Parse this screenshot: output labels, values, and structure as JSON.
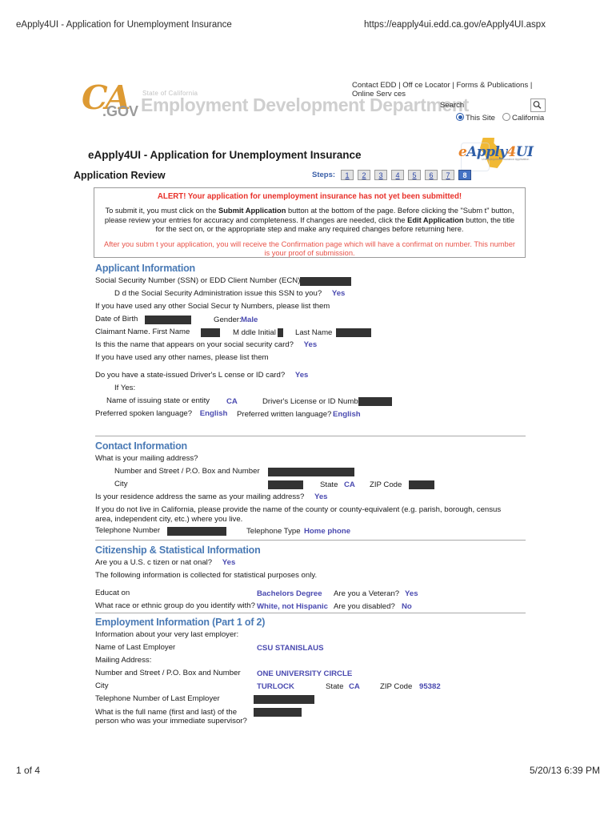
{
  "print": {
    "header_title": "eApply4UI - Application for Unemployment Insurance",
    "header_url": "https://eapply4ui.edd.ca.gov/eApply4UI.aspx",
    "footer_page": "1 of 4",
    "footer_date": "5/20/13 6:39 PM"
  },
  "banner": {
    "logo_ca": "CA",
    "logo_gov": ".GOV",
    "state_line": "State of California",
    "department": "Employment Development Department",
    "links": [
      "Contact EDD",
      "Off ce Locator",
      "Forms & Publications",
      "Online Serv ces"
    ],
    "separator": "|",
    "search_label": "Search",
    "search_icon": "search-icon",
    "scope_options": [
      {
        "label": "This Site",
        "selected": true
      },
      {
        "label": "California",
        "selected": false
      }
    ]
  },
  "logo": {
    "e": "e",
    "apply": "Apply",
    "four": "4",
    "ui": "UI",
    "tagline": "Unemployment Insurance Application"
  },
  "header": {
    "page_title": "eApply4UI - Application for Unemployment Insurance",
    "review_title": "Application Review",
    "steps_label": "Steps:",
    "steps": [
      "1",
      "2",
      "3",
      "4",
      "5",
      "6",
      "7",
      "8"
    ],
    "current_step": "8"
  },
  "alert": {
    "headline": "ALERT! Your application for unemployment insurance has not yet been submitted!",
    "body_1": "To submit it, you must click on the ",
    "body_bold_1": "Submit Application",
    "body_2": " button at the bottom of the page. Before clicking the \"Subm t\" button, please review your entries for accuracy and completeness. If changes are needed, click the ",
    "body_bold_2": "Edit Application",
    "body_3": " button, the title for the sect on, or the appropriate step and make any required changes before returning here.",
    "footer": "After you subm t your application, you will receive the Confirmation page which will have a confirmat on number. This number is your proof of submission."
  },
  "applicant": {
    "heading": "Applicant Information",
    "ssn_label": "Social Security Number (SSN) or EDD Client Number (ECN)",
    "ssn_value": "",
    "ssa_issue_label": "D d the Social Security Administration issue this SSN to you?",
    "ssa_issue_value": "Yes",
    "other_ssn_label": "If you have used any other Social Secur ty Numbers, please list them",
    "dob_label": "Date of Birth",
    "dob_value": "",
    "gender_label": "Gender:",
    "gender_value": "Male",
    "name_label": "Claimant Name.",
    "first_name_label": "First Name",
    "first_name_value": "",
    "middle_initial_label": "M ddle Initial",
    "middle_initial_value": "",
    "last_name_label": "Last Name",
    "last_name_value": "",
    "ss_card_label": "Is this the name that appears on your social security card?",
    "ss_card_value": "Yes",
    "other_names_label": "If you have used any other names, please list them",
    "dl_label": "Do you have a state-issued Driver's L cense or ID card?",
    "dl_value": "Yes",
    "if_yes_label": "If Yes:",
    "issuing_state_label": "Name of issuing state or entity",
    "issuing_state_value": "CA",
    "dl_number_label": "Driver's License or ID Number",
    "dl_number_value": "",
    "spoken_lang_label": "Preferred spoken language?",
    "spoken_lang_value": "English",
    "written_lang_label": "Preferred written language?",
    "written_lang_value": "English"
  },
  "contact": {
    "heading": "Contact Information",
    "mailing_label": "What is your mailing address?",
    "street_label": "Number and Street / P.O. Box and Number",
    "street_value": "",
    "city_label": "City",
    "city_value": "",
    "state_label": "State",
    "state_value": "CA",
    "zip_label": "ZIP Code",
    "zip_value": "",
    "same_address_label": "Is your residence address the same as your mailing address?",
    "same_address_value": "Yes",
    "county_note": "If you do not live in California, please provide the name of the county or county-equivalent (e.g. parish, borough, census area, independent city, etc.) where you live.",
    "phone_label": "Telephone Number",
    "phone_value": "",
    "phone_type_label": "Telephone Type",
    "phone_type_value": "Home phone"
  },
  "citizenship": {
    "heading": "Citizenship & Statistical Information",
    "citizen_label": "Are you a U.S. c tizen or nat onal?",
    "citizen_value": "Yes",
    "stat_note": "The following information is collected for statistical purposes only.",
    "education_label": "Educat on",
    "education_value": "Bachelors Degree",
    "veteran_label": "Are you a Veteran?",
    "veteran_value": "Yes",
    "race_label": "What race or ethnic group do you identify with?",
    "race_value": "White, not Hispanic",
    "disabled_label": "Are you disabled?",
    "disabled_value": "No"
  },
  "employment": {
    "heading": "Employment Information (Part 1 of 2)",
    "intro": "Information about your very last employer:",
    "employer_label": "Name of Last Employer",
    "employer_value": "CSU STANISLAUS",
    "mailing_label": "Mailing Address:",
    "street_label": "Number and Street / P.O. Box and Number",
    "street_value": "ONE UNIVERSITY CIRCLE",
    "city_label": "City",
    "city_value": "TURLOCK",
    "state_label": "State",
    "state_value": "CA",
    "zip_label": "ZIP Code",
    "zip_value": "95382",
    "phone_label": "Telephone Number of Last Employer",
    "phone_value": "",
    "supervisor_label_1": "What is the full name (first and last) of the",
    "supervisor_label_2": "person who was your immediate supervisor?",
    "supervisor_value": ""
  },
  "colors": {
    "section_heading": "#4a7ab5",
    "answer_value": "#4a4ab0",
    "alert_red": "#e8312a",
    "step_active": "#4472c4",
    "redaction": "#333333"
  }
}
